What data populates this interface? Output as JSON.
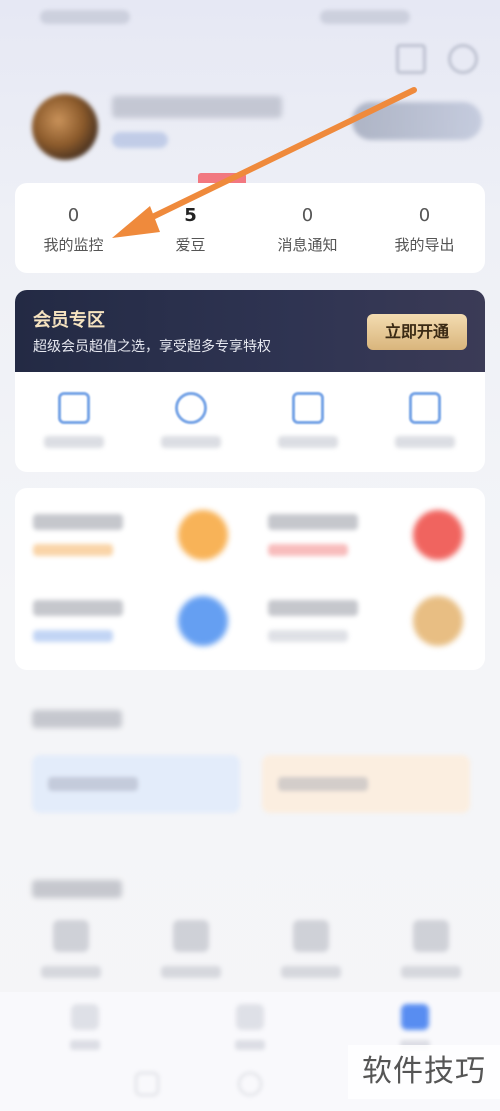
{
  "stats": [
    {
      "value": "0",
      "label": "我的监控"
    },
    {
      "value": "5",
      "label": "爱豆"
    },
    {
      "value": "0",
      "label": "消息通知"
    },
    {
      "value": "0",
      "label": "我的导出"
    }
  ],
  "member": {
    "title": "会员专区",
    "subtitle": "超级会员超值之选，享受超多专享特权",
    "button": "立即开通"
  },
  "watermark": "软件技巧",
  "colors": {
    "member_bg": "#232a44",
    "member_title": "#f6e3c0",
    "button_gold": "#d9b57c",
    "annotation_arrow": "#ef8a3c",
    "accent_blue": "#4a86de"
  },
  "icons": {
    "top_left": "scan-icon",
    "top_right": "settings-icon",
    "entry_1": "document-icon",
    "entry_2": "user-icon",
    "entry_3": "clipboard-icon",
    "entry_4": "chat-icon"
  }
}
